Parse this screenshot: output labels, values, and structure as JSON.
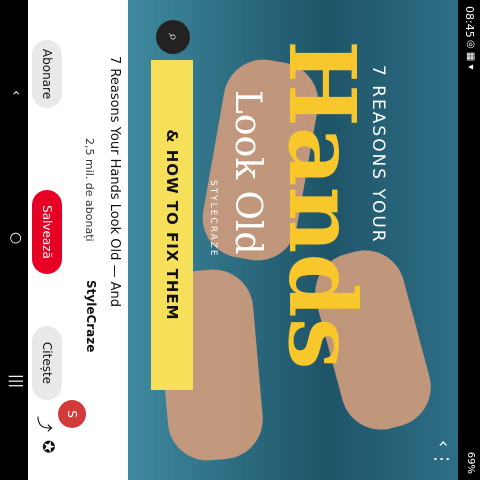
{
  "status": {
    "time": "08:45",
    "battery": "69%"
  },
  "pin": {
    "pre_title": "7 REASONS YOUR",
    "big_title": "Hands",
    "sub_title": "Look Old",
    "brand": "STYLECRAZE",
    "banner": "& HOW TO FIX THEM"
  },
  "panel": {
    "pin_title": "7 Reasons Your Hands Look Old — And",
    "username": "StyleCraze",
    "followers": "2,5 mil. de abonați",
    "follow_label": "Abonare",
    "save_label": "Salvează",
    "visit_label": "Citește"
  },
  "icons": {
    "back": "back-arrow-icon",
    "more": "more-dots-icon",
    "lens": "visual-search-icon",
    "share": "share-icon",
    "pin": "pinterest-icon",
    "home": "home-icon",
    "recents": "recents-icon"
  },
  "colors": {
    "save": "#e60023",
    "banner": "#f6e05a",
    "title": "#f7c72c"
  }
}
